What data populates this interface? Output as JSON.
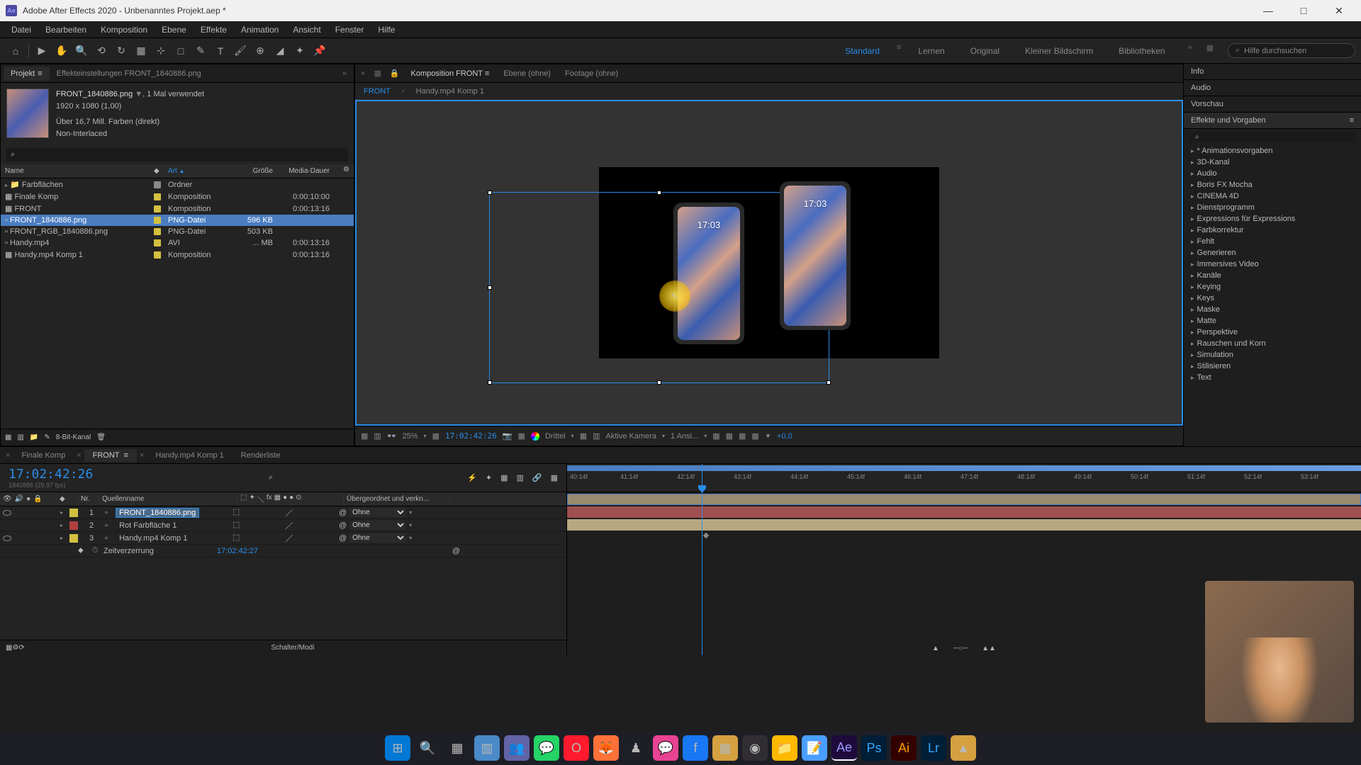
{
  "window": {
    "title": "Adobe After Effects 2020 - Unbenanntes Projekt.aep *",
    "minimize": "—",
    "maximize": "□",
    "close": "✕"
  },
  "menu": [
    "Datei",
    "Bearbeiten",
    "Komposition",
    "Ebene",
    "Effekte",
    "Animation",
    "Ansicht",
    "Fenster",
    "Hilfe"
  ],
  "workspaces": {
    "items": [
      "Standard",
      "Lernen",
      "Original",
      "Kleiner Bildschirm",
      "Bibliotheken"
    ],
    "active": "Standard",
    "search_placeholder": "Hilfe durchsuchen"
  },
  "project": {
    "tab_project": "Projekt",
    "tab_effects": "Effekteinstellungen FRONT_1840886.png",
    "asset_name": "FRONT_1840886.png",
    "asset_used": ", 1 Mal verwendet",
    "asset_dims": "1920 x 1080 (1,00)",
    "asset_colors": "Über 16,7 Mill. Farben (direkt)",
    "asset_interlace": "Non-Interlaced",
    "cols": {
      "name": "Name",
      "art": "Art",
      "size": "Größe",
      "dur": "Media-Dauer"
    },
    "rows": [
      {
        "name": "Farbflächen",
        "art": "Ordner",
        "size": "",
        "dur": "",
        "tag": "#888",
        "folder": true
      },
      {
        "name": "Finale Komp",
        "art": "Komposition",
        "size": "",
        "dur": "0:00:10:00",
        "tag": "#d4c040"
      },
      {
        "name": "FRONT",
        "art": "Komposition",
        "size": "",
        "dur": "0:00:13:16",
        "tag": "#d4c040"
      },
      {
        "name": "FRONT_1840886.png",
        "art": "PNG-Datei",
        "size": "596 KB",
        "dur": "",
        "tag": "#d4c040",
        "selected": true
      },
      {
        "name": "FRONT_RGB_1840886.png",
        "art": "PNG-Datei",
        "size": "503 KB",
        "dur": "",
        "tag": "#d4c040"
      },
      {
        "name": "Handy.mp4",
        "art": "AVI",
        "size": "... MB",
        "dur": "0:00:13:16",
        "tag": "#d4c040"
      },
      {
        "name": "Handy.mp4 Komp 1",
        "art": "Komposition",
        "size": "",
        "dur": "0:00:13:16",
        "tag": "#d4c040"
      }
    ],
    "footer_bpc": "8-Bit-Kanal"
  },
  "comp": {
    "tab_label": "Komposition FRONT",
    "tab_ebene": "Ebene (ohne)",
    "tab_footage": "Footage (ohne)",
    "subtab_front": "FRONT",
    "subtab_handy": "Handy.mp4 Komp 1",
    "phone_time": "17:03",
    "zoom": "25%",
    "timecode": "17:02:42:26",
    "resolution": "Drittel",
    "camera": "Aktive Kamera",
    "views": "1 Ansi...",
    "exposure": "+0,0"
  },
  "right": {
    "info": "Info",
    "audio": "Audio",
    "vorschau": "Vorschau",
    "effects_title": "Effekte und Vorgaben",
    "categories": [
      "* Animationsvorgaben",
      "3D-Kanal",
      "Audio",
      "Boris FX Mocha",
      "CINEMA 4D",
      "Dienstprogramm",
      "Expressions für Expressions",
      "Farbkorrektur",
      "Fehlt",
      "Generieren",
      "Immersives Video",
      "Kanäle",
      "Keying",
      "Keys",
      "Maske",
      "Matte",
      "Perspektive",
      "Rauschen und Korn",
      "Simulation",
      "Stilisieren",
      "Text"
    ]
  },
  "timeline": {
    "tabs": [
      "Finale Komp",
      "FRONT",
      "Handy.mp4 Komp 1",
      "Renderliste"
    ],
    "active_tab": "FRONT",
    "timecode": "17:02:42:26",
    "timecode_sub": "1840886 (29,97 fps)",
    "col_nr": "Nr.",
    "col_quelle": "Quellenname",
    "col_parent": "Übergeordnet und verkn...",
    "parent_none": "Ohne",
    "layers": [
      {
        "idx": "1",
        "name": "FRONT_1840886.png",
        "color": "#d4c040",
        "selected": true
      },
      {
        "idx": "2",
        "name": "Rot Farbfläche 1",
        "color": "#b04040"
      },
      {
        "idx": "3",
        "name": "Handy.mp4 Komp 1",
        "color": "#d4c040"
      }
    ],
    "prop_zeitverzerrung": "Zeitverzerrung",
    "prop_value": "17:02:42:27",
    "ruler_ticks": [
      "41:14f",
      "42:14f",
      "43:14f",
      "44:14f",
      "45:14f",
      "46:14f",
      "47:14f",
      "48:14f",
      "49:14f",
      "50:14f",
      "51:14f",
      "52:14f",
      "53:14f"
    ],
    "ruler_start": "40:14f",
    "footer": "Schalter/Modi"
  },
  "taskbar": {
    "icons": [
      "windows",
      "search",
      "taskview",
      "explorer",
      "teams",
      "whatsapp",
      "opera",
      "firefox",
      "app1",
      "messenger",
      "facebook",
      "app2",
      "obs",
      "folder",
      "notepad",
      "ae",
      "ps",
      "ai",
      "lr",
      "app3"
    ]
  }
}
